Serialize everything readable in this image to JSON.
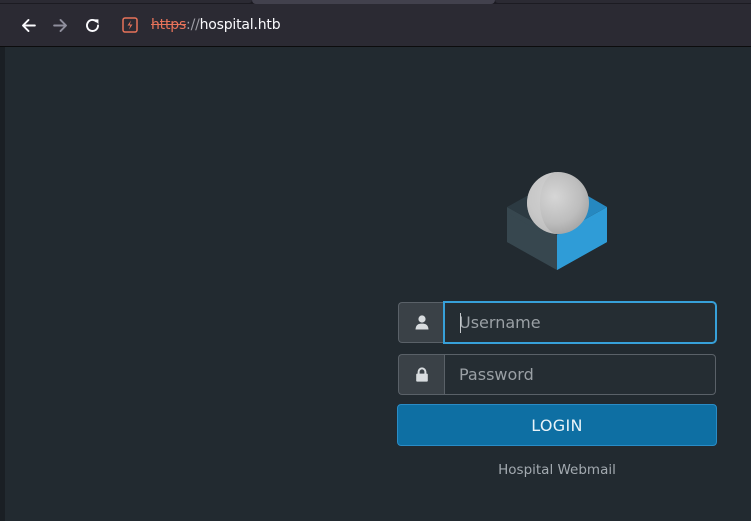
{
  "browser": {
    "url_scheme": "https",
    "url_separator": "://",
    "url_host": "hospital.htb",
    "icons": {
      "back": "arrow-left-icon",
      "forward": "arrow-right-icon",
      "reload": "reload-icon",
      "site": "insecure-connection-icon"
    }
  },
  "login": {
    "username_placeholder": "Username",
    "password_placeholder": "Password",
    "submit_label": "LOGIN",
    "footer": "Hospital Webmail",
    "icons": {
      "logo": "roundcube-logo",
      "username": "user-icon",
      "password": "lock-icon"
    }
  },
  "colors": {
    "page_background": "#222a30",
    "accent": "#37a0d9",
    "button": "#0e6fa3",
    "insecure_scheme": "#e8735a"
  }
}
